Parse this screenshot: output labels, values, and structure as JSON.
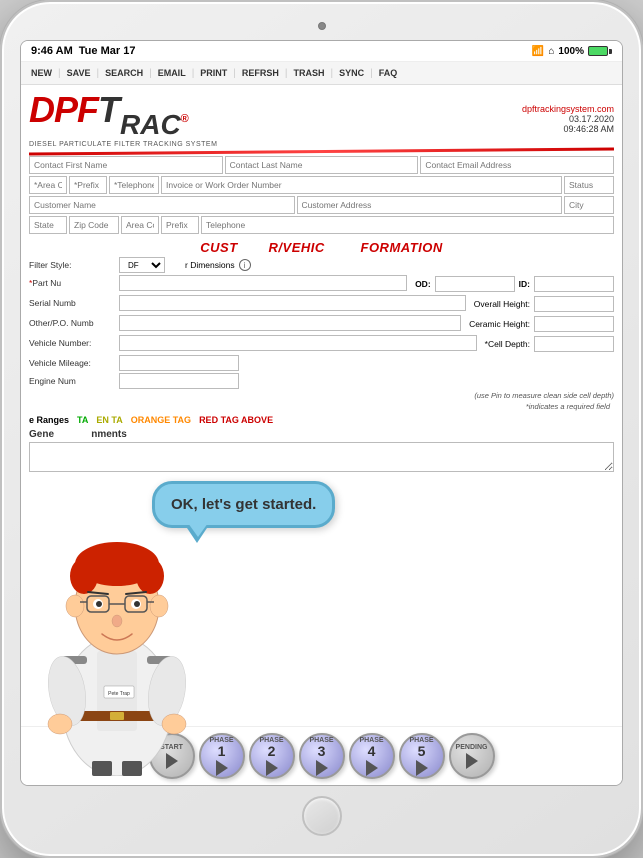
{
  "device": {
    "time": "9:46 AM",
    "date": "Tue Mar 17",
    "wifi_signal": "WiFi",
    "battery": "100%"
  },
  "toolbar": {
    "items": [
      "NEW",
      "SAVE",
      "SEARCH",
      "EMAIL",
      "PRINT",
      "REFRSH",
      "TRASH",
      "SYNC",
      "FAQ"
    ]
  },
  "logo": {
    "dpf": "DPF",
    "trac": "T",
    "rac": "RAC",
    "subtitle": "DIESEL PARTICULATE FILTER TRACKING SYSTEM",
    "website": "dpftrackingsystem.com",
    "date_display": "03.17.2020",
    "time_display": "09:46:28 AM"
  },
  "form": {
    "contact_first_name": "Contact First Name",
    "contact_last_name": "Contact Last Name",
    "contact_email": "Contact Email Address",
    "area_code": "*Area Code",
    "prefix": "*Prefix",
    "telephone": "*Telephone",
    "invoice": "Invoice or Work Order Number",
    "status": "Status",
    "customer_name": "Customer Name",
    "customer_address": "Customer Address",
    "city": "City",
    "state": "State",
    "zip": "Zip Code",
    "area_code2": "Area Code",
    "prefix2": "Prefix",
    "telephone2": "Telephone"
  },
  "vehicle_section": {
    "title": "CUST    VEHIC      FORMATION",
    "title_full": "CUSTOMER/VEHICLE INFORMATION",
    "filter_style_label": "Filter Style:",
    "filter_style_val": "DF",
    "part_number_label": "*Part Nu",
    "serial_label": "Serial Numb",
    "other_po_label": "Other/P.O. Numb",
    "vehicle_number_label": "Vehicle Number:",
    "vehicle_mileage_label": "Vehicle Mileage:",
    "engine_num_label": "Engine Num",
    "filter_dimensions_label": "r Dimensions",
    "od_label": "OD:",
    "id_label": "ID:",
    "overall_height_label": "Overall Height:",
    "ceramic_height_label": "Ceramic Height:",
    "cell_depth_label": "*Cell Depth:",
    "pin_note": "(use Pin to measure clean side cell depth)",
    "required_note": "*indicates a required field"
  },
  "tag_ranges": {
    "title": "e Ranges",
    "green": "TA",
    "yellow": "EN TA",
    "orange": "ORANGE TAG",
    "red": "RED TAG ABOVE"
  },
  "general_comments": {
    "title": "Gene    nments",
    "title_full": "General Comments"
  },
  "speech_bubble": {
    "text": "OK, let's get started."
  },
  "phases": [
    {
      "label": "START",
      "type": "start"
    },
    {
      "label": "PHASE",
      "number": "1",
      "type": "phase"
    },
    {
      "label": "PHASE",
      "number": "2",
      "type": "phase"
    },
    {
      "label": "PHASE",
      "number": "3",
      "type": "phase"
    },
    {
      "label": "PHASE",
      "number": "4",
      "type": "phase"
    },
    {
      "label": "PHASE",
      "number": "5",
      "type": "phase"
    },
    {
      "label": "PENDING",
      "type": "pending"
    }
  ]
}
